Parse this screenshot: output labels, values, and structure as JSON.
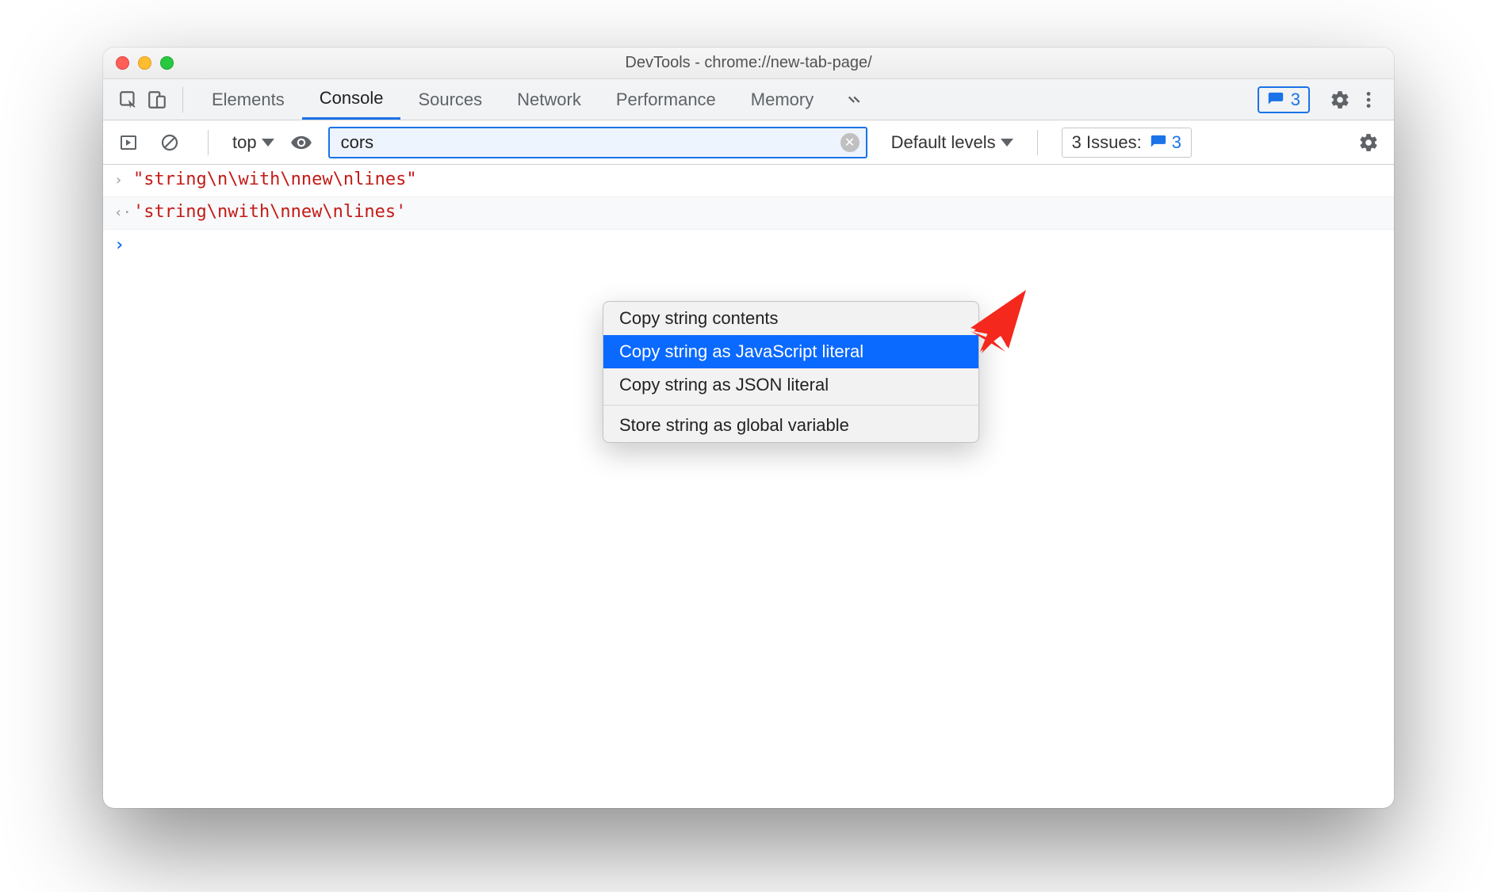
{
  "window": {
    "title": "DevTools - chrome://new-tab-page/"
  },
  "tabstrip": {
    "tabs": [
      "Elements",
      "Console",
      "Sources",
      "Network",
      "Performance",
      "Memory"
    ],
    "activeIndex": 1,
    "issues_chip_count": "3"
  },
  "toolrow": {
    "context": "top",
    "filter_value": "cors",
    "levels": "Default levels",
    "issues_label": "3 Issues:",
    "issues_count": "3"
  },
  "console": {
    "input_line": "\"string\\n\\with\\nnew\\nlines\"",
    "result_line": "'string\\nwith\\nnew\\nlines'"
  },
  "context_menu": {
    "items": [
      "Copy string contents",
      "Copy string as JavaScript literal",
      "Copy string as JSON literal"
    ],
    "selectedIndex": 1,
    "footer_item": "Store string as global variable"
  }
}
